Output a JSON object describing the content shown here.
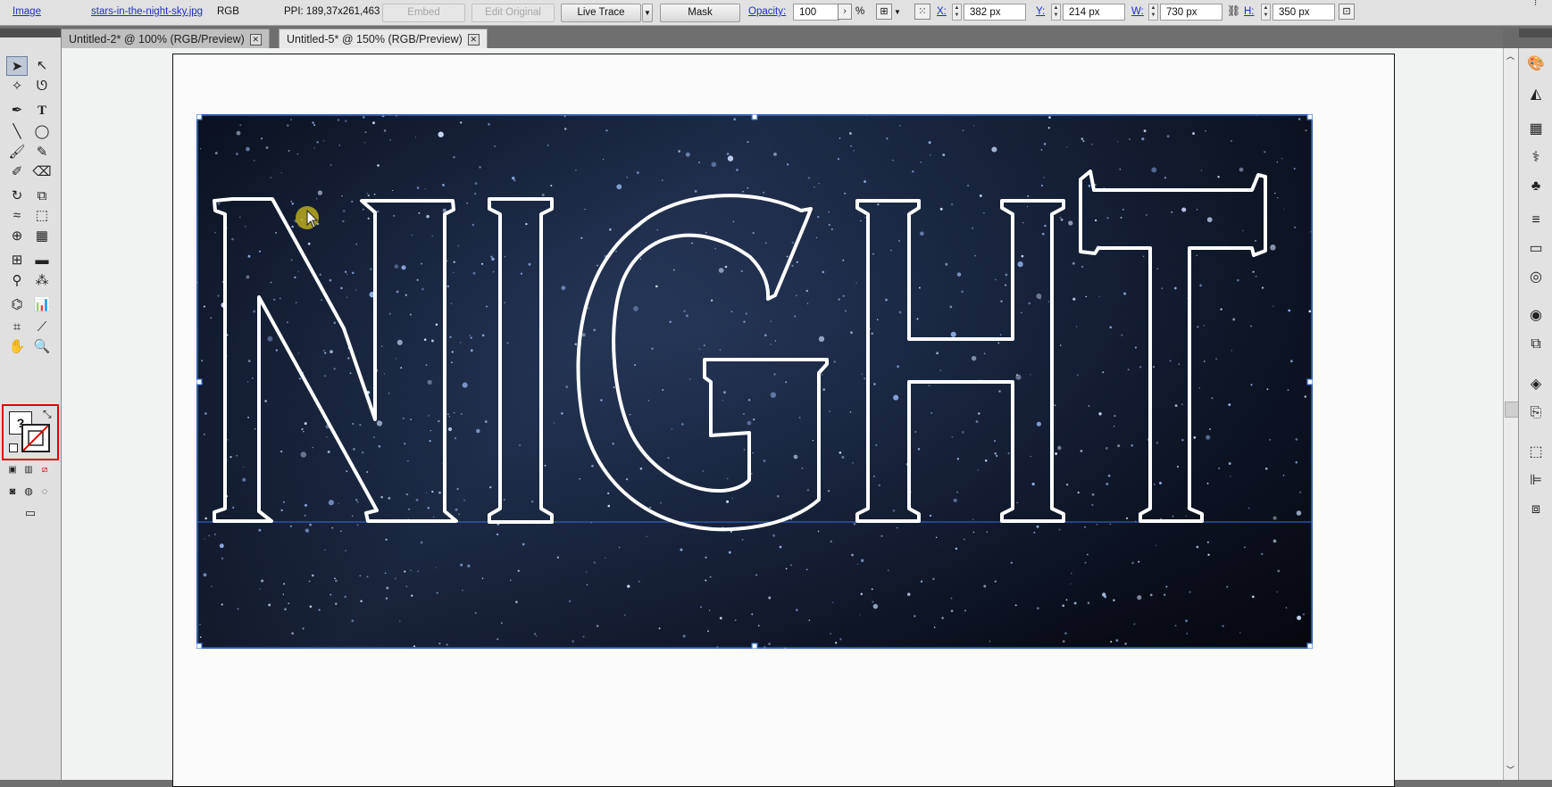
{
  "control_bar": {
    "object_type": "Image",
    "file_name": "stars-in-the-night-sky.jpg",
    "color_mode": "RGB",
    "ppi": "PPI: 189,37x261,463",
    "embed_label": "Embed",
    "edit_original_label": "Edit Original",
    "live_trace_label": "Live Trace",
    "mask_label": "Mask",
    "opacity_label": "Opacity:",
    "opacity_value": "100",
    "opacity_unit": "%",
    "x_label": "X:",
    "x_value": "382 px",
    "y_label": "Y:",
    "y_value": "214 px",
    "w_label": "W:",
    "w_value": "730 px",
    "h_label": "H:",
    "h_value": "350 px"
  },
  "tabs": [
    {
      "label": "Untitled-2* @ 100% (RGB/Preview)"
    },
    {
      "label": "Untitled-5* @ 150% (RGB/Preview)"
    }
  ],
  "artwork": {
    "outlined_text": "NIGHT"
  },
  "colors": {
    "selection": "#3a6fd8",
    "highlight_box": "#e00000"
  }
}
